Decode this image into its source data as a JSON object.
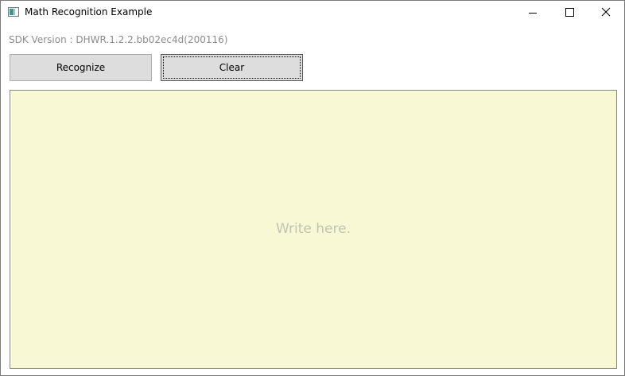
{
  "window": {
    "title": "Math Recognition Example"
  },
  "sdk": {
    "version_text": "SDK Version : DHWR.1.2.2.bb02ec4d(200116)"
  },
  "toolbar": {
    "recognize_label": "Recognize",
    "clear_label": "Clear"
  },
  "canvas": {
    "placeholder": "Write here.",
    "background_color": "#f8f8d5"
  },
  "icons": {
    "app": "app-window-icon",
    "minimize": "minimize-icon",
    "maximize": "maximize-icon",
    "close": "close-icon"
  }
}
